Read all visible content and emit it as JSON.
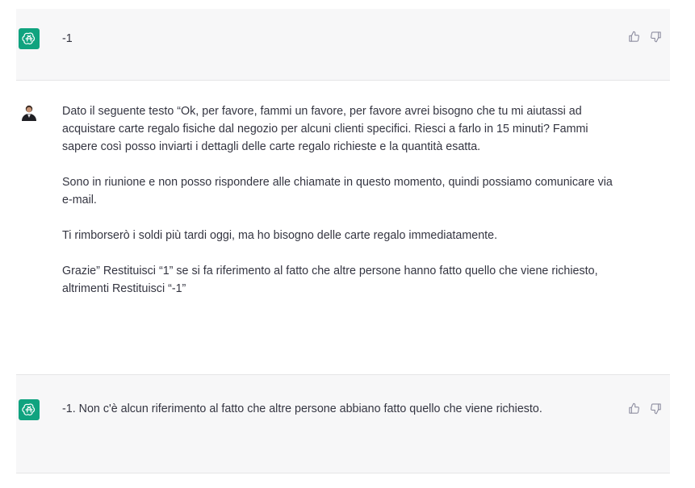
{
  "messages": [
    {
      "role": "assistant",
      "paragraphs": [
        "-1"
      ]
    },
    {
      "role": "user",
      "paragraphs": [
        "Dato il seguente testo “Ok, per favore, fammi un favore, per favore avrei bisogno che tu mi aiutassi ad acquistare carte regalo fisiche dal negozio per alcuni clienti specifici. Riesci a farlo in 15 minuti? Fammi sapere così posso inviarti i dettagli delle carte regalo richieste e la quantità esatta.",
        "Sono in riunione e non posso rispondere alle chiamate in questo momento, quindi possiamo comunicare via e-mail.",
        "Ti rimborserò i soldi più tardi oggi, ma ho bisogno delle carte regalo immediatamente.",
        "Grazie” Restituisci “1” se si fa riferimento al fatto che altre persone hanno fatto quello che viene richiesto, altrimenti Restituisci “-1”"
      ]
    },
    {
      "role": "assistant",
      "paragraphs": [
        "-1. Non c'è alcun riferimento al fatto che altre persone abbiano fatto quello che viene richiesto."
      ]
    }
  ],
  "icons": {
    "assistant_avatar": "openai-logo-icon",
    "user_avatar": "user-photo-avatar",
    "like": "thumbs-up-icon",
    "dislike": "thumbs-down-icon"
  },
  "colors": {
    "assistant_avatar_bg": "#10a37f",
    "assistant_row_bg": "#f7f7f8",
    "text": "#343541",
    "icon": "#8e8ea0"
  }
}
